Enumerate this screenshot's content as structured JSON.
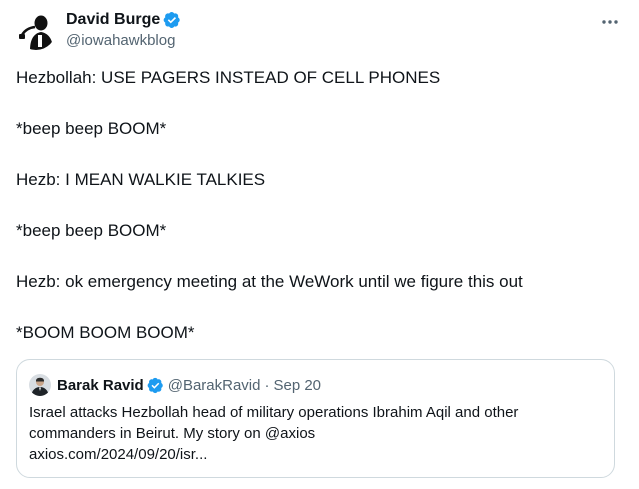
{
  "tweet": {
    "author": {
      "name": "David Burge",
      "handle": "@iowahawkblog",
      "verified": true
    },
    "more_icon": "more-horizontal-icon",
    "paragraphs": [
      "Hezbollah: USE PAGERS INSTEAD OF CELL PHONES",
      "*beep beep BOOM*",
      "Hezb: I MEAN WALKIE TALKIES",
      "*beep beep BOOM*",
      "Hezb: ok emergency meeting at the WeWork until we figure this out",
      "*BOOM BOOM BOOM*"
    ]
  },
  "quoted_tweet": {
    "author": {
      "name": "Barak Ravid",
      "handle": "@BarakRavid",
      "verified": true
    },
    "separator": "·",
    "date": "Sep 20",
    "text_lines": [
      "Israel attacks Hezbollah head of military operations Ibrahim Aqil and other",
      "commanders in Beirut. My story on @axios",
      "axios.com/2024/09/20/isr..."
    ]
  },
  "colors": {
    "text": "#0f1419",
    "secondary": "#536471",
    "verified_blue": "#1d9bf0",
    "border": "#cfd9de"
  }
}
